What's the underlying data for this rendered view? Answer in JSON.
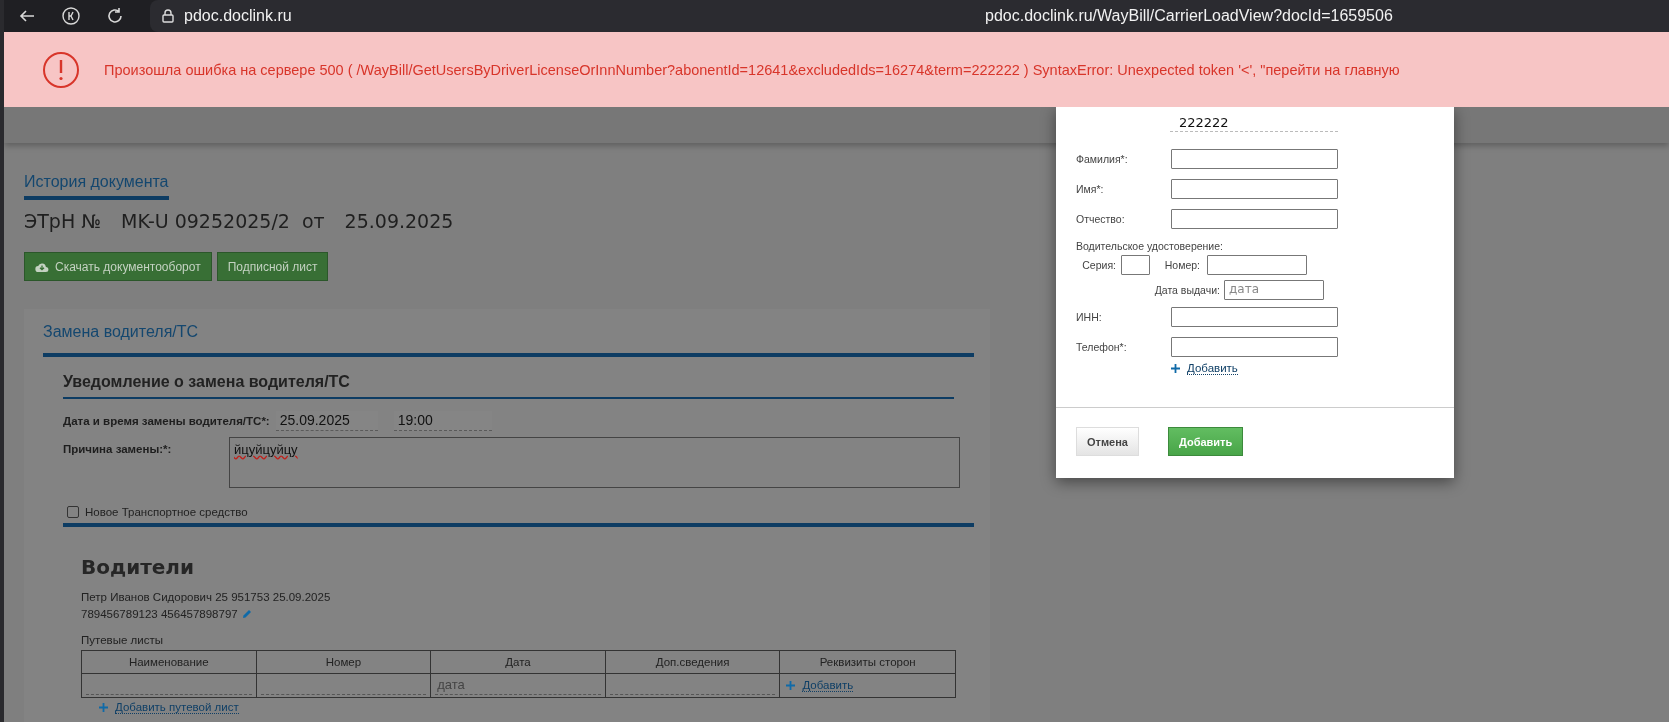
{
  "browser": {
    "host": "pdoc.doclink.ru",
    "url": "pdoc.doclink.ru/WayBill/CarrierLoadView?docId=1659506"
  },
  "error_banner": {
    "message": "Произошла ошибка на сервере 500 ( /WayBill/GetUsersByDriverLicenseOrInnNumber?abonentId=12641&excludedIds=16274&term=222222 ) SyntaxError: Unexpected token '<', \"перейти на главную"
  },
  "document": {
    "history_tab": "История документа",
    "doc_type": "ЭТрН №",
    "number": "MK-U 09252025/2",
    "from": "от",
    "date": "25.09.2025",
    "buttons": [
      {
        "label": "Скачать документооборот",
        "kind": "download"
      },
      {
        "label": "Подписной лист",
        "kind": "plain"
      }
    ]
  },
  "section_tabs": [
    {
      "label": "Замена водителя/ТС",
      "selected": true
    }
  ],
  "notice": {
    "title": "Уведомление о замена водителя/ТС",
    "datetime_label": "Дата и время замены водителя/ТС*:",
    "date_value": "25.09.2025",
    "time_value": "19:00",
    "reason_label": "Причина замены:*:",
    "reason_value": "йцуйцуйцу",
    "new_vehicle": {
      "label": "Новое Транспортное средство",
      "checked": false
    }
  },
  "drivers": {
    "title": "Водители",
    "lines": [
      "Петр Иванов Сидорович 25 951753 25.09.2025",
      "789456789123 456457898797"
    ],
    "waybills_label": "Путевые листы",
    "columns": [
      "Наименование",
      "Номер",
      "Дата",
      "Доп.сведения",
      "Реквизиты сторон"
    ],
    "row": {
      "date_placeholder": "дата",
      "add_link": "Добавить"
    },
    "add_waybill_link": "Добавить путевой лист"
  },
  "modal": {
    "search_value": "222222",
    "rows": [
      {
        "kind": "text",
        "label": "Фамилия*:"
      },
      {
        "kind": "text",
        "label": "Имя*:"
      },
      {
        "kind": "text",
        "label": "Отчество:"
      },
      {
        "kind": "license",
        "label": "Водительское удостоверение:",
        "series_label": "Серия:",
        "number_label": "Номер:",
        "issue_date_label": "Дата выдачи:",
        "issue_date_placeholder": "дата"
      },
      {
        "kind": "text",
        "label": "ИНН:"
      },
      {
        "kind": "text",
        "label": "Телефон*:"
      }
    ],
    "add_phone_link": "Добавить",
    "buttons": [
      {
        "label": "Отмена",
        "kind": "secondary"
      },
      {
        "label": "Добавить",
        "kind": "primary"
      }
    ]
  }
}
